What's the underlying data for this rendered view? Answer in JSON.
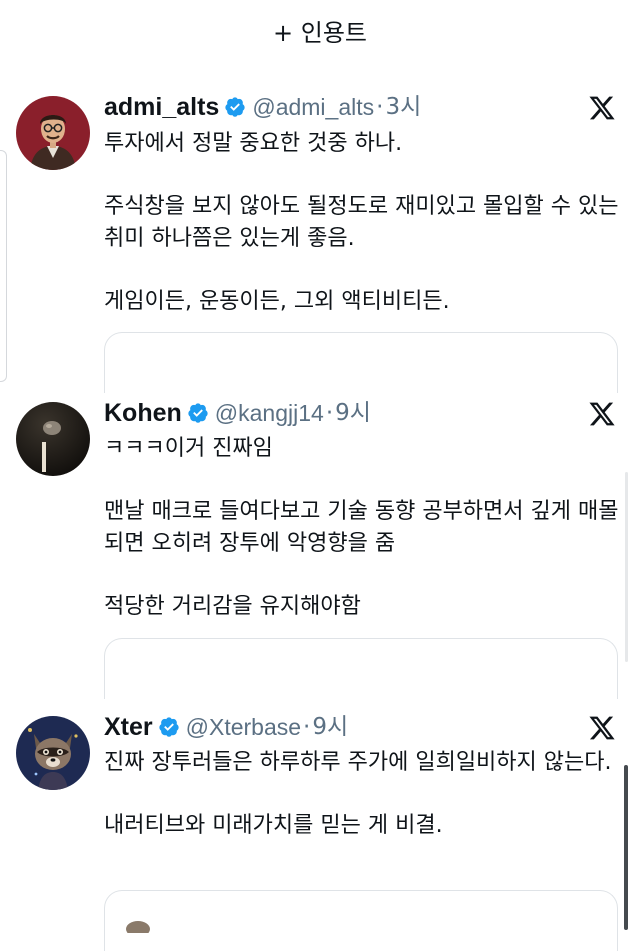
{
  "header": {
    "title": "+ 인용트"
  },
  "posts": [
    {
      "name": "admi_alts",
      "handle": "@admi_alts",
      "separator": "·",
      "time": "3시",
      "verified": true,
      "avatar_icon": "man-with-glasses-avatar",
      "text": "투자에서 정말 중요한 것중 하나.\n\n주식창을 보지 않아도 될정도로 재미있고 몰입할 수 있는 취미 하나쯤은 있는게 좋음.\n\n게임이든, 운동이든, 그외 액티비티든."
    },
    {
      "name": "Kohen",
      "handle": "@kangjj14",
      "separator": "·",
      "time": "9시",
      "verified": true,
      "avatar_icon": "dark-moon-avatar",
      "text": "ㅋㅋㅋ이거 진짜임\n\n맨날 매크로 들여다보고 기술 동향 공부하면서 깊게 매몰되면 오히려 장투에 악영향을 줌\n\n적당한 거리감을 유지해야함"
    },
    {
      "name": "Xter",
      "handle": "@Xterbase",
      "separator": "·",
      "time": "9시",
      "verified": true,
      "avatar_icon": "raccoon-avatar",
      "text": "진짜 장투러들은 하루하루 주가에 일희일비하지 않는다.\n\n내러티브와 미래가치를 믿는 게 비결."
    }
  ],
  "colors": {
    "text": "#0f1419",
    "muted": "#5b7083",
    "verified_blue": "#1d9bf0",
    "border": "#dfe3e7"
  }
}
